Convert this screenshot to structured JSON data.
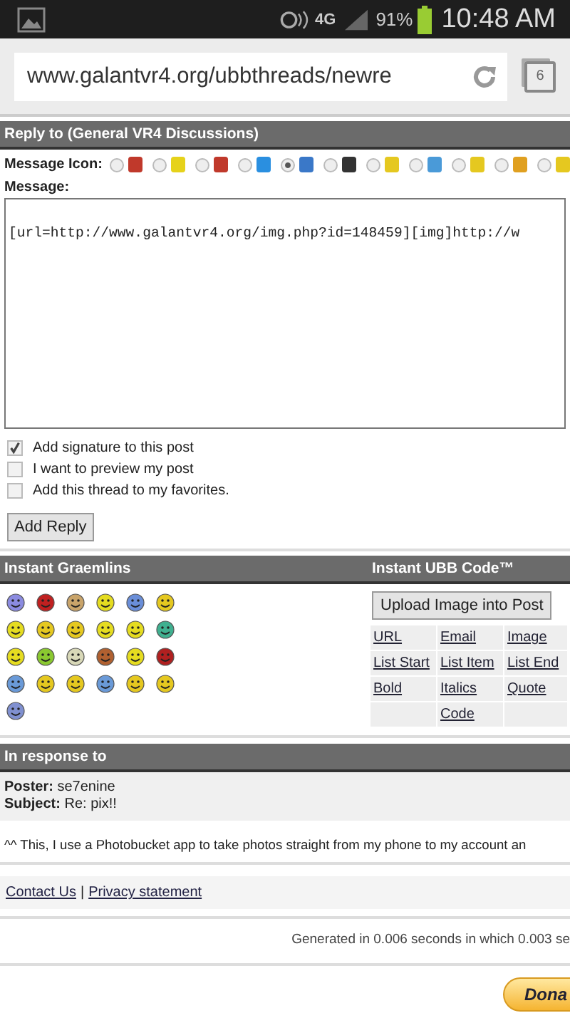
{
  "status_bar": {
    "network": "4G",
    "battery": "91%",
    "time": "10:48 AM"
  },
  "browser": {
    "url": "www.galantvr4.org/ubbthreads/newre",
    "tab_count": "6"
  },
  "reply_form": {
    "title": "Reply to (General VR4 Discussions)",
    "icon_label": "Message Icon:",
    "icons": [
      {
        "selected": false
      },
      {
        "selected": false
      },
      {
        "selected": false
      },
      {
        "selected": false
      },
      {
        "selected": true
      },
      {
        "selected": false
      },
      {
        "selected": false
      },
      {
        "selected": false
      },
      {
        "selected": false
      },
      {
        "selected": false
      },
      {
        "selected": false
      }
    ],
    "message_label": "Message:",
    "message": "[url=http://www.galantvr4.org/img.php?id=148459][img]http://w",
    "options": [
      {
        "label": "Add signature to this post",
        "checked": true
      },
      {
        "label": "I want to preview my post",
        "checked": false
      },
      {
        "label": "Add this thread to my favorites.",
        "checked": false
      }
    ],
    "submit": "Add Reply"
  },
  "graemlins": {
    "title": "Instant Graemlins"
  },
  "ubb_code": {
    "title": "Instant UBB Code™",
    "upload": "Upload Image into Post",
    "links": [
      "URL",
      "Email",
      "Image",
      "List Start",
      "List Item",
      "List End",
      "Bold",
      "Italics",
      "Quote",
      "Code"
    ]
  },
  "response": {
    "title": "In response to",
    "poster_label": "Poster:",
    "poster": "se7enine",
    "subject_label": "Subject:",
    "subject": "Re: pix!!",
    "body": "^^ This, I use a Photobucket app to take photos straight from my phone to my account an"
  },
  "footer": {
    "links": [
      "Contact Us",
      "Privacy statement"
    ],
    "separator": "|",
    "generated": "Generated in 0.006 seconds in which 0.003 se",
    "donate": "Dona"
  }
}
